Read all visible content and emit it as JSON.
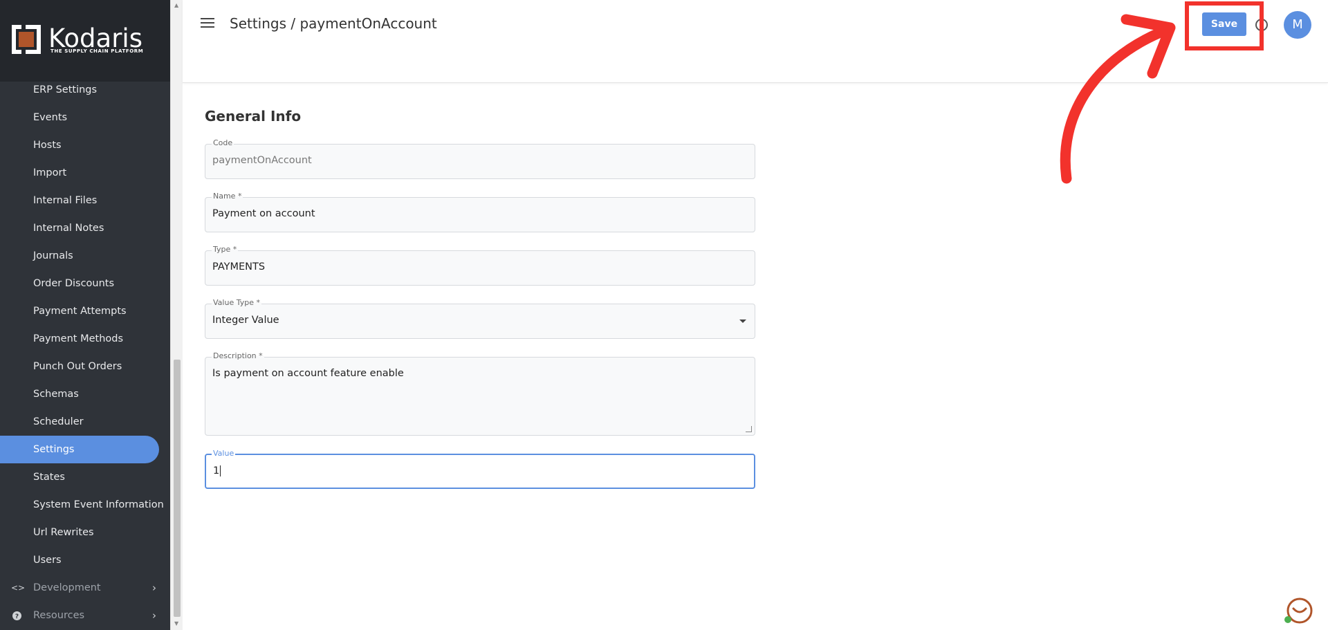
{
  "app": {
    "logo_text": "Kodaris",
    "logo_tagline": "THE SUPPLY CHAIN PLATFORM"
  },
  "sidebar": {
    "items": [
      {
        "label": "ERP Settings"
      },
      {
        "label": "Events"
      },
      {
        "label": "Hosts"
      },
      {
        "label": "Import"
      },
      {
        "label": "Internal Files"
      },
      {
        "label": "Internal Notes"
      },
      {
        "label": "Journals"
      },
      {
        "label": "Order Discounts"
      },
      {
        "label": "Payment Attempts"
      },
      {
        "label": "Payment Methods"
      },
      {
        "label": "Punch Out Orders"
      },
      {
        "label": "Schemas"
      },
      {
        "label": "Scheduler"
      },
      {
        "label": "Settings",
        "active": true
      },
      {
        "label": "States"
      },
      {
        "label": "System Event Information"
      },
      {
        "label": "Url Rewrites"
      },
      {
        "label": "Users"
      }
    ],
    "sections": [
      {
        "label": "Development",
        "icon": "code-icon"
      },
      {
        "label": "Resources",
        "icon": "help-circle-icon"
      }
    ]
  },
  "header": {
    "title": "Settings / paymentOnAccount",
    "save_label": "Save",
    "avatar_initial": "M"
  },
  "form": {
    "section_title": "General Info",
    "code": {
      "label": "Code",
      "value": "paymentOnAccount"
    },
    "name": {
      "label": "Name *",
      "value": "Payment on account"
    },
    "type": {
      "label": "Type *",
      "value": "PAYMENTS"
    },
    "value_type": {
      "label": "Value Type *",
      "value": "Integer Value"
    },
    "description": {
      "label": "Description *",
      "value": "Is payment on account feature enable"
    },
    "value": {
      "label": "Value",
      "value": "1"
    }
  },
  "colors": {
    "accent": "#5b8fe0",
    "sidebar_bg": "#2f3339",
    "annotation": "#f2322c"
  }
}
